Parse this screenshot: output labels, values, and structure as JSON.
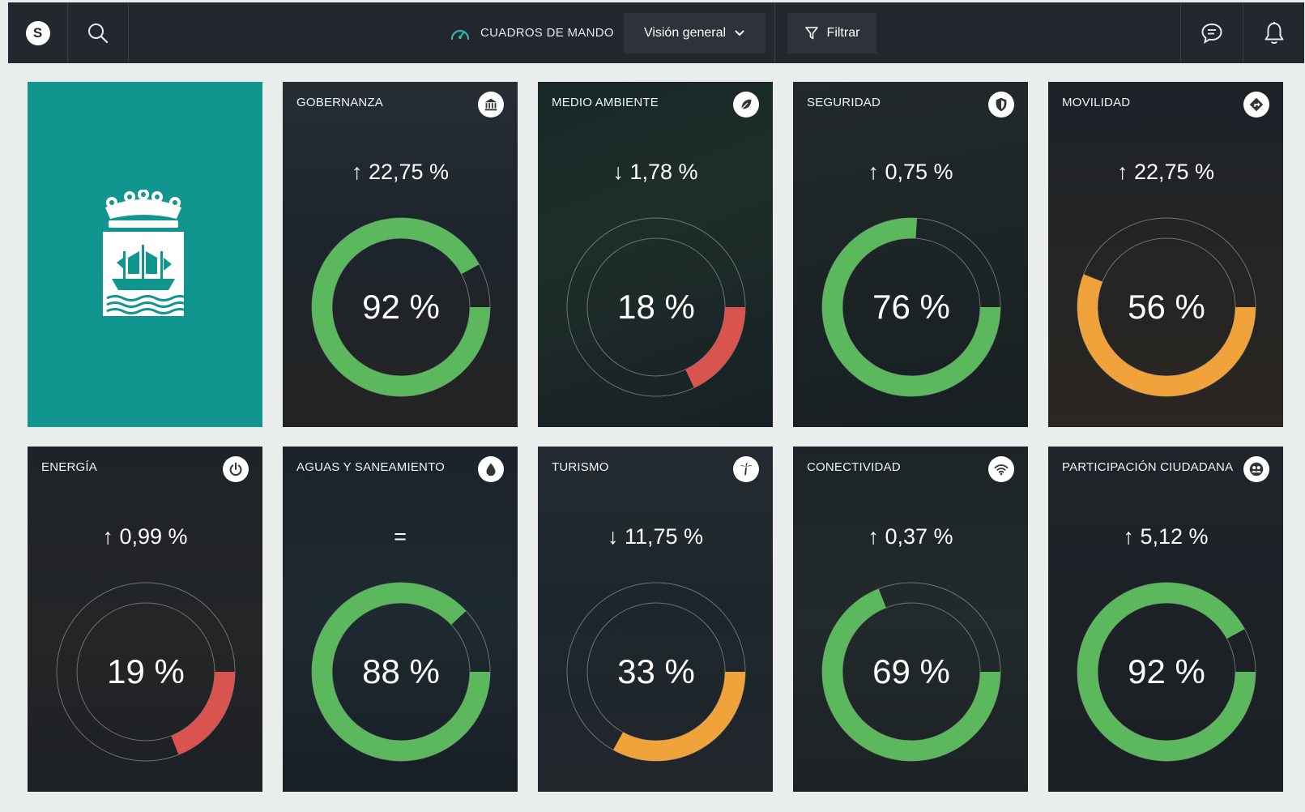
{
  "topbar": {
    "logo_letter": "S",
    "title": "CUADROS DE MANDO",
    "view_select": "Visión general",
    "filter_label": "Filtrar"
  },
  "colors": {
    "topbar_bg": "#23272e",
    "brand_teal": "#11958f",
    "gauge_green": "#5cb85c",
    "gauge_red": "#d9534f",
    "gauge_orange": "#f0a33a",
    "page_bg": "#e9eeec"
  },
  "cards": [
    {
      "title": "GOBERNANZA",
      "icon": "building-icon",
      "trend": "↑ 22,75 %",
      "value": "92 %",
      "percent": 92,
      "color": "green"
    },
    {
      "title": "MEDIO AMBIENTE",
      "icon": "leaf-icon",
      "trend": "↓ 1,78 %",
      "value": "18 %",
      "percent": 18,
      "color": "red"
    },
    {
      "title": "SEGURIDAD",
      "icon": "shield-icon",
      "trend": "↑ 0,75 %",
      "value": "76 %",
      "percent": 76,
      "color": "green"
    },
    {
      "title": "MOVILIDAD",
      "icon": "directions-icon",
      "trend": "↑ 22,75 %",
      "value": "56 %",
      "percent": 56,
      "color": "orange"
    },
    {
      "title": "ENERGÍA",
      "icon": "power-icon",
      "trend": "↑ 0,99 %",
      "value": "19 %",
      "percent": 19,
      "color": "red"
    },
    {
      "title": "AGUAS Y SANEAMIENTO",
      "icon": "water-drop-icon",
      "trend": "=",
      "value": "88 %",
      "percent": 88,
      "color": "green"
    },
    {
      "title": "TURISMO",
      "icon": "palm-tree-icon",
      "trend": "↓ 11,75 %",
      "value": "33 %",
      "percent": 33,
      "color": "orange"
    },
    {
      "title": "CONECTIVIDAD",
      "icon": "wifi-icon",
      "trend": "↑ 0,37 %",
      "value": "69 %",
      "percent": 69,
      "color": "green"
    },
    {
      "title": "PARTICIPACIÓN CIUDADANA",
      "icon": "people-icon",
      "trend": "↑ 5,12 %",
      "value": "92 %",
      "percent": 92,
      "color": "green"
    }
  ]
}
